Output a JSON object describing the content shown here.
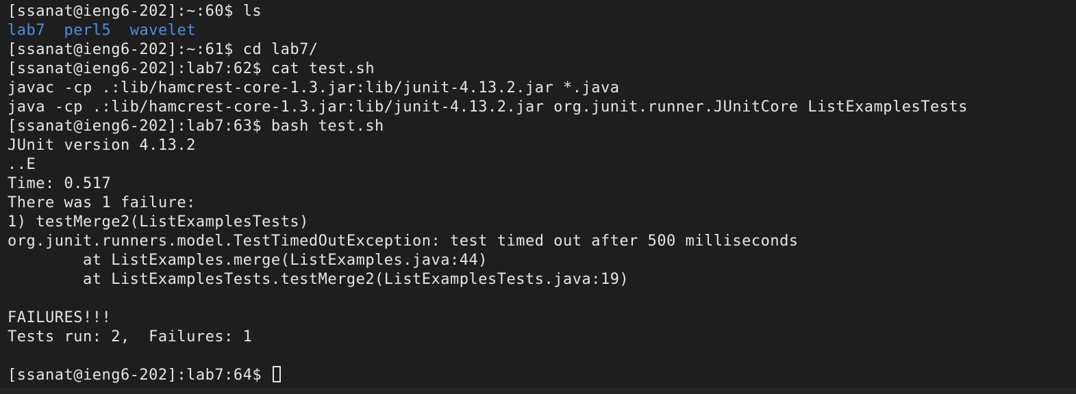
{
  "terminal": {
    "lines": [
      "[ssanat@ieng6-202]:~:60$ ls",
      "",
      "[ssanat@ieng6-202]:~:61$ cd lab7/",
      "[ssanat@ieng6-202]:lab7:62$ cat test.sh",
      "javac -cp .:lib/hamcrest-core-1.3.jar:lib/junit-4.13.2.jar *.java",
      "java -cp .:lib/hamcrest-core-1.3.jar:lib/junit-4.13.2.jar org.junit.runner.JUnitCore ListExamplesTests",
      "[ssanat@ieng6-202]:lab7:63$ bash test.sh",
      "JUnit version 4.13.2",
      "..E",
      "Time: 0.517",
      "There was 1 failure:",
      "1) testMerge2(ListExamplesTests)",
      "org.junit.runners.model.TestTimedOutException: test timed out after 500 milliseconds",
      "        at ListExamples.merge(ListExamples.java:44)",
      "        at ListExamplesTests.testMerge2(ListExamplesTests.java:19)",
      "",
      "FAILURES!!!",
      "Tests run: 2,  Failures: 1",
      "",
      "[ssanat@ieng6-202]:lab7:64$ "
    ],
    "ls_output": [
      "lab7",
      "perl5",
      "wavelet"
    ],
    "colors": {
      "background": "#1e1e1e",
      "foreground": "#e6e6e6",
      "directory": "#4e8de8"
    }
  }
}
